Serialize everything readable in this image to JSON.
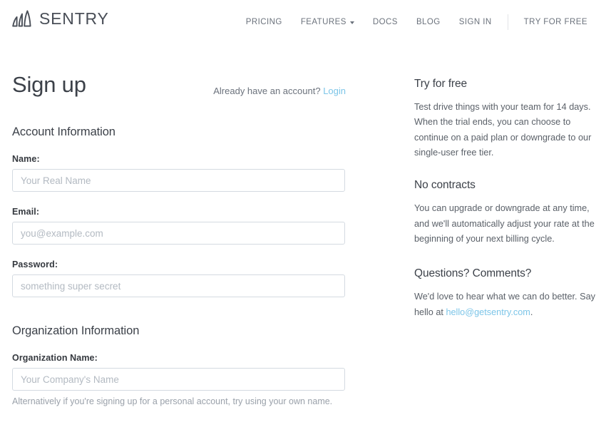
{
  "header": {
    "brand_name": "SENTRY",
    "logo_icon": "sentry-wave-logo",
    "nav": [
      {
        "label": "PRICING",
        "name": "nav-pricing",
        "caret": false
      },
      {
        "label": "FEATURES",
        "name": "nav-features",
        "caret": true
      },
      {
        "label": "DOCS",
        "name": "nav-docs",
        "caret": false
      },
      {
        "label": "BLOG",
        "name": "nav-blog",
        "caret": false
      },
      {
        "label": "SIGN IN",
        "name": "nav-sign-in",
        "caret": false
      }
    ],
    "cta_label": "TRY FOR FREE"
  },
  "signup": {
    "title": "Sign up",
    "already_have_account": "Already have an account?",
    "login_label": "Login",
    "account_section_title": "Account Information",
    "organization_section_title": "Organization Information",
    "fields": {
      "name": {
        "label": "Name:",
        "placeholder": "Your Real Name",
        "value": ""
      },
      "email": {
        "label": "Email:",
        "placeholder": "you@example.com",
        "value": ""
      },
      "password": {
        "label": "Password:",
        "placeholder": "something super secret",
        "value": ""
      },
      "organization": {
        "label": "Organization Name:",
        "placeholder": "Your Company's Name",
        "value": ""
      }
    },
    "organization_help": "Alternatively if you're signing up for a personal account, try using your own name."
  },
  "aside": {
    "try_for_free": {
      "title": "Try for free",
      "body": "Test drive things with your team for 14 days. When the trial ends, you can choose to continue on a paid plan or downgrade to our single-user free tier."
    },
    "no_contracts": {
      "title": "No contracts",
      "body": "You can upgrade or downgrade at any time, and we'll automatically adjust your rate at the beginning of your next billing cycle."
    },
    "questions": {
      "title": "Questions? Comments?",
      "body_before": "We'd love to hear what we can do better. Say hello at ",
      "email": "hello@getsentry.com",
      "body_after": "."
    }
  },
  "colors": {
    "link_blue": "#7cc5e8",
    "text_dark": "#3c4149",
    "text_muted": "#6b727c",
    "border": "#d4dae1"
  }
}
